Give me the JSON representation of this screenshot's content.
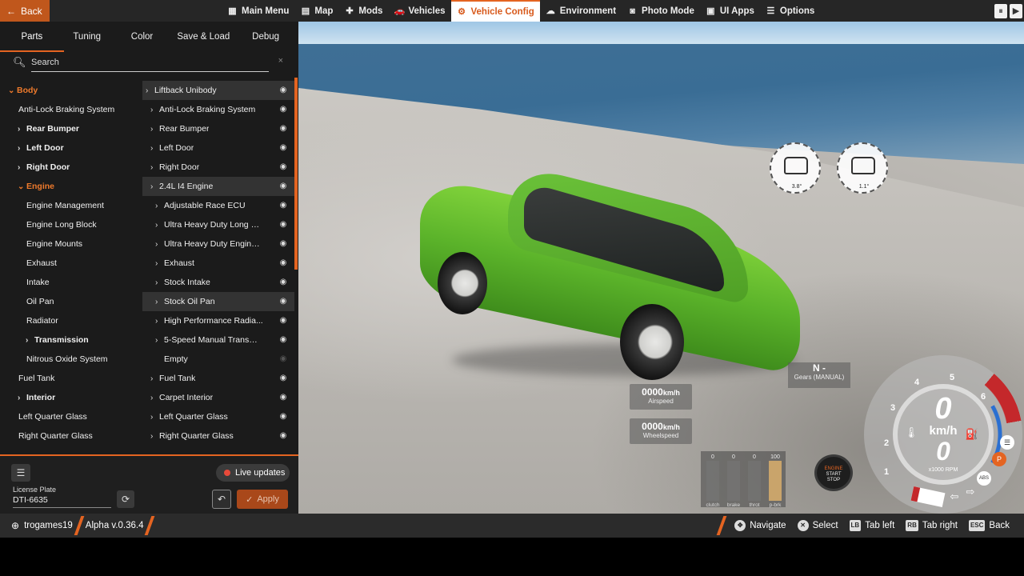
{
  "topbar": {
    "back_label": "Back",
    "menu": [
      {
        "label": "Main Menu",
        "icon": "grid-icon"
      },
      {
        "label": "Map",
        "icon": "map-icon"
      },
      {
        "label": "Mods",
        "icon": "puzzle-icon"
      },
      {
        "label": "Vehicles",
        "icon": "car-icon"
      },
      {
        "label": "Vehicle Config",
        "icon": "engine-icon",
        "active": true
      },
      {
        "label": "Environment",
        "icon": "weather-icon"
      },
      {
        "label": "Photo Mode",
        "icon": "camera-icon"
      },
      {
        "label": "UI Apps",
        "icon": "apps-icon"
      },
      {
        "label": "Options",
        "icon": "sliders-icon"
      }
    ],
    "accent": "#e46421"
  },
  "panel": {
    "tabs": [
      "Parts",
      "Tuning",
      "Color",
      "Save & Load",
      "Debug"
    ],
    "active_tab": "Parts",
    "search_placeholder": "Search",
    "search_clear": "×",
    "left_tree": [
      {
        "label": "Body",
        "chevron": "down",
        "bold": true,
        "orange": true,
        "indent": 0
      },
      {
        "label": "Anti-Lock Braking System",
        "chevron": "",
        "bold": false,
        "indent": 1
      },
      {
        "label": "Rear Bumper",
        "chevron": "right",
        "bold": true,
        "indent": 1
      },
      {
        "label": "Left Door",
        "chevron": "right",
        "bold": true,
        "indent": 1
      },
      {
        "label": "Right Door",
        "chevron": "right",
        "bold": true,
        "indent": 1
      },
      {
        "label": "Engine",
        "chevron": "down",
        "bold": true,
        "orange": true,
        "indent": 1
      },
      {
        "label": "Engine Management",
        "chevron": "",
        "bold": false,
        "indent": 2
      },
      {
        "label": "Engine Long Block",
        "chevron": "",
        "bold": false,
        "indent": 2
      },
      {
        "label": "Engine Mounts",
        "chevron": "",
        "bold": false,
        "indent": 2
      },
      {
        "label": "Exhaust",
        "chevron": "",
        "bold": false,
        "indent": 2
      },
      {
        "label": "Intake",
        "chevron": "",
        "bold": false,
        "indent": 2
      },
      {
        "label": "Oil Pan",
        "chevron": "",
        "bold": false,
        "indent": 2
      },
      {
        "label": "Radiator",
        "chevron": "",
        "bold": false,
        "indent": 2
      },
      {
        "label": "Transmission",
        "chevron": "right",
        "bold": true,
        "indent": 2
      },
      {
        "label": "Nitrous Oxide System",
        "chevron": "",
        "bold": false,
        "indent": 2
      },
      {
        "label": "Fuel Tank",
        "chevron": "",
        "bold": false,
        "indent": 1
      },
      {
        "label": "Interior",
        "chevron": "right",
        "bold": true,
        "indent": 1
      },
      {
        "label": "Left Quarter Glass",
        "chevron": "",
        "bold": false,
        "indent": 1
      },
      {
        "label": "Right Quarter Glass",
        "chevron": "",
        "bold": false,
        "indent": 1
      }
    ],
    "right_tree": [
      {
        "label": "Liftback Unibody",
        "indent": 0,
        "hl": true
      },
      {
        "label": "Anti-Lock Braking System",
        "indent": 1
      },
      {
        "label": "Rear Bumper",
        "indent": 1
      },
      {
        "label": "Left Door",
        "indent": 1
      },
      {
        "label": "Right Door",
        "indent": 1
      },
      {
        "label": "2.4L I4 Engine",
        "indent": 1,
        "hl": true
      },
      {
        "label": "Adjustable Race ECU",
        "indent": 2
      },
      {
        "label": "Ultra Heavy Duty Long B...",
        "indent": 2
      },
      {
        "label": "Ultra Heavy Duty Engine ...",
        "indent": 2
      },
      {
        "label": "Exhaust",
        "indent": 2
      },
      {
        "label": "Stock Intake",
        "indent": 2
      },
      {
        "label": "Stock Oil Pan",
        "indent": 2,
        "hl": true
      },
      {
        "label": "High Performance Radia...",
        "indent": 2
      },
      {
        "label": "5-Speed Manual Transmi...",
        "indent": 2
      },
      {
        "label": "Empty",
        "indent": 2,
        "dim": true
      },
      {
        "label": "Fuel Tank",
        "indent": 1
      },
      {
        "label": "Carpet Interior",
        "indent": 1
      },
      {
        "label": "Left Quarter Glass",
        "indent": 1
      },
      {
        "label": "Right Quarter Glass",
        "indent": 1
      }
    ],
    "live_updates": "Live updates",
    "license_label": "License Plate",
    "license_value": "DTI-6635",
    "apply_label": "Apply"
  },
  "hud": {
    "tilt_front": "3.8°",
    "tilt_side": "1.1°",
    "gear": "N -",
    "gear_caption": "Gears (MANUAL)",
    "airspeed": "0000",
    "airspeed_unit": "km/h",
    "airspeed_caption": "Airspeed",
    "wheelspeed": "0000",
    "wheelspeed_unit": "km/h",
    "wheelspeed_caption": "Wheelspeed",
    "pedals": [
      {
        "value": "0",
        "label": "clutch",
        "level": 0
      },
      {
        "value": "0",
        "label": "brake",
        "level": 0
      },
      {
        "value": "0",
        "label": "throt",
        "level": 0
      },
      {
        "value": "100",
        "label": "p-brk",
        "level": 100
      }
    ],
    "engine_button": [
      "ENGINE",
      "START",
      "STOP"
    ],
    "speed": "0",
    "speed_unit": "km/h",
    "rpm": "0",
    "rpm_unit": "x1000 RPM",
    "rpm_marks": [
      "1",
      "2",
      "3",
      "4",
      "5",
      "6"
    ],
    "abs_label": "ABS",
    "parking_label": "P"
  },
  "bottombar": {
    "username": "trogames19",
    "version": "Alpha v.0.36.4",
    "hints": [
      {
        "key": "✥",
        "label": "Navigate"
      },
      {
        "key": "✕",
        "label": "Select"
      },
      {
        "key": "LB",
        "label": "Tab left"
      },
      {
        "key": "RB",
        "label": "Tab right"
      },
      {
        "key": "ESC",
        "label": "Back"
      }
    ]
  }
}
